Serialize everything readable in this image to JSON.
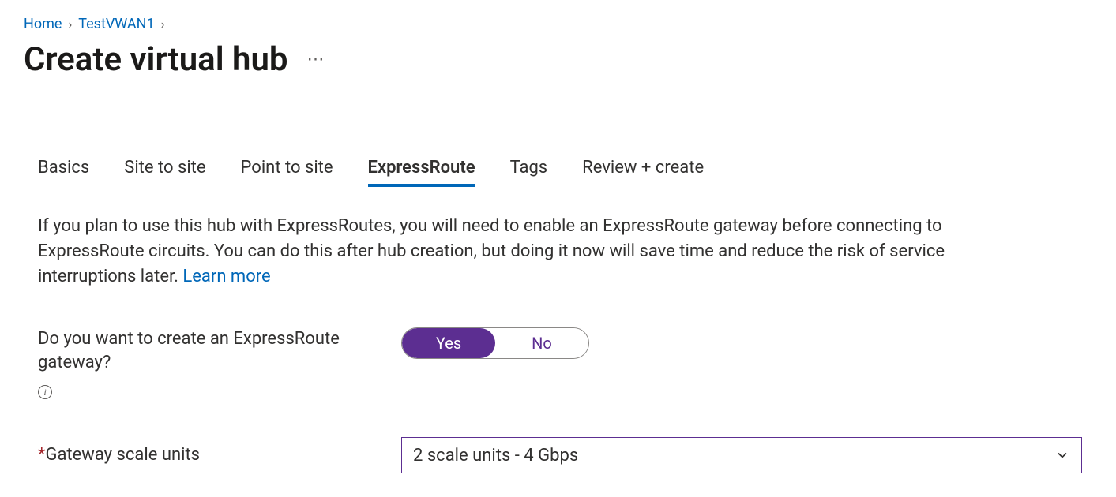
{
  "breadcrumb": {
    "home": "Home",
    "item1": "TestVWAN1"
  },
  "page": {
    "title": "Create virtual hub"
  },
  "tabs": {
    "basics": "Basics",
    "site_to_site": "Site to site",
    "point_to_site": "Point to site",
    "expressroute": "ExpressRoute",
    "tags": "Tags",
    "review_create": "Review + create"
  },
  "intro": {
    "text": "If you plan to use this hub with ExpressRoutes, you will need to enable an ExpressRoute gateway before connecting to ExpressRoute circuits. You can do this after hub creation, but doing it now will save time and reduce the risk of service interruptions later.  ",
    "learn_more": "Learn more"
  },
  "form": {
    "create_gateway_label": "Do you want to create an ExpressRoute gateway?",
    "yes": "Yes",
    "no": "No",
    "scale_units_label": "Gateway scale units",
    "scale_units_value": "2 scale units - 4 Gbps"
  }
}
